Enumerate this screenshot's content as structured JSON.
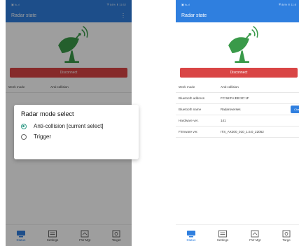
{
  "colors": {
    "accent": "#2f7fdf",
    "danger": "#d94545",
    "radar": "#3a9a4a",
    "radio": "#2f9a86"
  },
  "left": {
    "app_title": "Radar state",
    "status_left": "▣ ℡.ıl",
    "status_right": "⛨ 84% ▮ 11:52",
    "menu_icon": "⋮",
    "disconnect_label": "Disconnect",
    "visible_rows": [
      {
        "key": "Work mode",
        "value": "Anti-collision"
      }
    ],
    "dialog": {
      "title": "Radar mode select",
      "options": [
        {
          "label": "Anti-collision  [current select]",
          "selected": true
        },
        {
          "label": "Trigger",
          "selected": false
        }
      ]
    },
    "tabs": [
      {
        "label": "Status",
        "icon": "status-icon"
      },
      {
        "label": "Settings",
        "icon": "settings-icon"
      },
      {
        "label": "FW Mgt",
        "icon": "firmware-icon"
      },
      {
        "label": "Target",
        "icon": "target-icon"
      }
    ]
  },
  "right": {
    "app_title": "Radar state",
    "status_left": "▣ ℡.ıl",
    "status_right": "⛨ 84% ▮ 11:5",
    "disconnect_label": "Disconnect",
    "rows": [
      {
        "key": "Work mode",
        "value": "Anti-collision"
      },
      {
        "key": "Bluetooth address",
        "value": "FC:58:FA:EB:3C:1F"
      },
      {
        "key": "Bluetooth name",
        "value": "Radaroverses"
      },
      {
        "key": "Hardware ver.",
        "value": "141"
      },
      {
        "key": "Firmware ver.",
        "value": "ITS_AX200_010_1.5.0_22052"
      }
    ],
    "change_label": "Chan",
    "tabs": [
      {
        "label": "Status",
        "icon": "status-icon"
      },
      {
        "label": "Settings",
        "icon": "settings-icon"
      },
      {
        "label": "FW Mgt",
        "icon": "firmware-icon"
      },
      {
        "label": "Targe",
        "icon": "target-icon"
      }
    ]
  }
}
